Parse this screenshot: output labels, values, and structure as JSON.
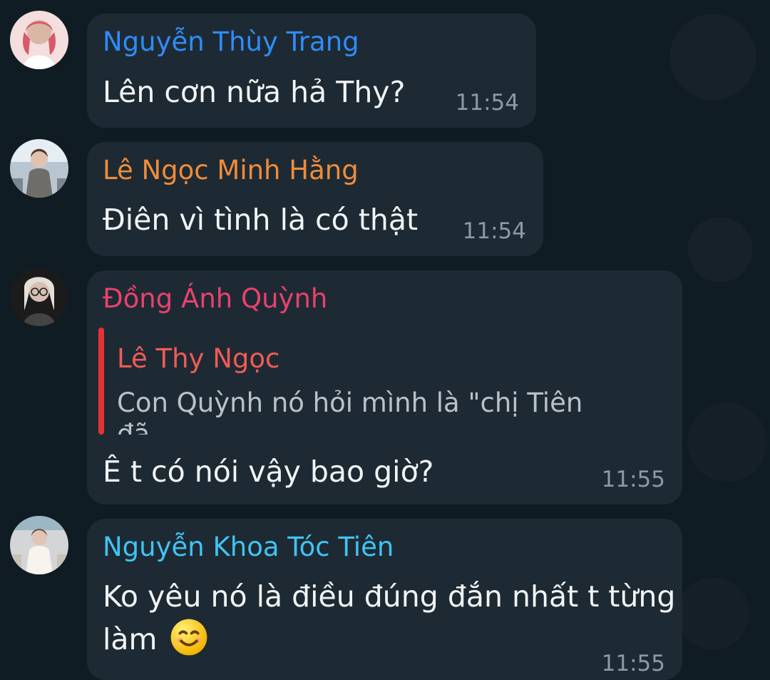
{
  "messages": [
    {
      "sender": "Nguyễn Thùy Trang",
      "sender_color": "#2f8cff",
      "text": "Lên cơn nữa hả Thy?",
      "time": "11:54"
    },
    {
      "sender": "Lê Ngọc Minh Hằng",
      "sender_color": "#f08c3a",
      "text": "Điên vì tình là có thật",
      "time": "11:54"
    },
    {
      "sender": "Đồng Ánh Quỳnh",
      "sender_color": "#e9416e",
      "reply": {
        "author": "Lê Thy Ngọc",
        "text": "Con Quỳnh nó hỏi mình là \"chị Tiên đã"
      },
      "text": "Ê t có nói vậy bao giờ?",
      "time": "11:55"
    },
    {
      "sender": "Nguyễn Khoa Tóc Tiên",
      "sender_color": "#3fc4f4",
      "text_line1": "Ko yêu nó là điều đúng đắn nhất t từng",
      "text_line2": "làm",
      "emoji": "smiling-face-emoji",
      "time": "11:55"
    }
  ],
  "colors": {
    "background": "#101c24",
    "bubble": "#1e2a33",
    "message_text": "#f1f4f6",
    "time_text": "#8a9aa6",
    "reply_bar": "#e53235",
    "reply_author": "#f05b57"
  }
}
